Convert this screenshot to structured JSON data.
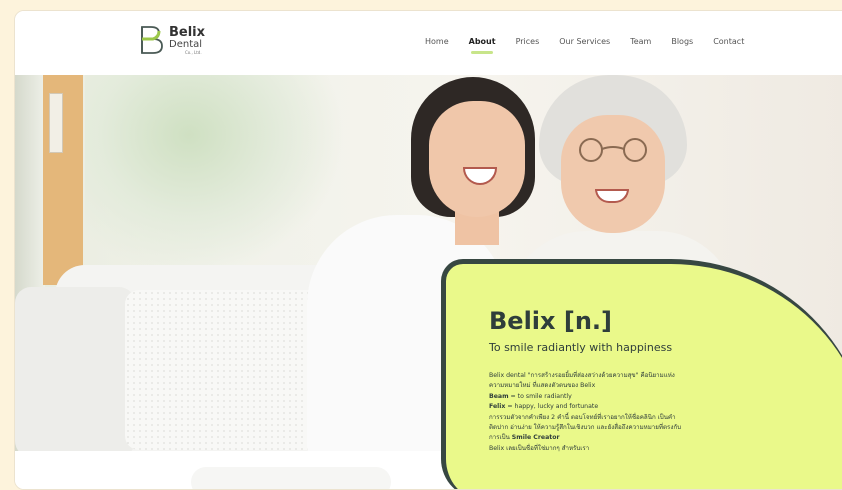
{
  "brand": {
    "name": "Belix",
    "sub": "Dental",
    "tiny": "Co., Ltd.",
    "accent": "#c8e58a",
    "card_color": "#eaf98a",
    "card_border": "#374742"
  },
  "nav": {
    "items": [
      {
        "label": "Home",
        "active": false
      },
      {
        "label": "About",
        "active": true
      },
      {
        "label": "Prices",
        "active": false
      },
      {
        "label": "Our Services",
        "active": false
      },
      {
        "label": "Team",
        "active": false
      },
      {
        "label": "Blogs",
        "active": false
      },
      {
        "label": "Contact",
        "active": false
      }
    ]
  },
  "hero": {
    "image_alt": "Two women smiling on a sofa"
  },
  "card": {
    "title": "Belix [n.]",
    "subtitle": "To smile radiantly with happiness",
    "line1": "Belix dental \"การสร้างรอยยิ้มที่ส่องสว่างด้วยความสุข\" คือนิยามแห่ง",
    "line2": "ความหมายใหม่ ที่แสดงตัวตนของ Belix",
    "beam_term": "Beam",
    "beam_def": " = to smile radiantly",
    "felix_term": "Felix",
    "felix_def": " = happy, lucky and fortunate",
    "line5": "การรวมตัวจากคำเพียง 2 คำนี้ ตอบโจทย์ที่เราอยากให้ชื่อคลินิก เป็นคำ",
    "line6": "ติดปาก อ่านง่าย ให้ความรู้สึกในเชิงบวก และยังสื่อถึงความหมายที่ตรงกับ",
    "line7_prefix": "การเป็น ",
    "line7_bold": "Smile Creator",
    "line8": "Belix เลยเป็นชื่อที่ใช่มากๆ สำหรับเรา"
  }
}
